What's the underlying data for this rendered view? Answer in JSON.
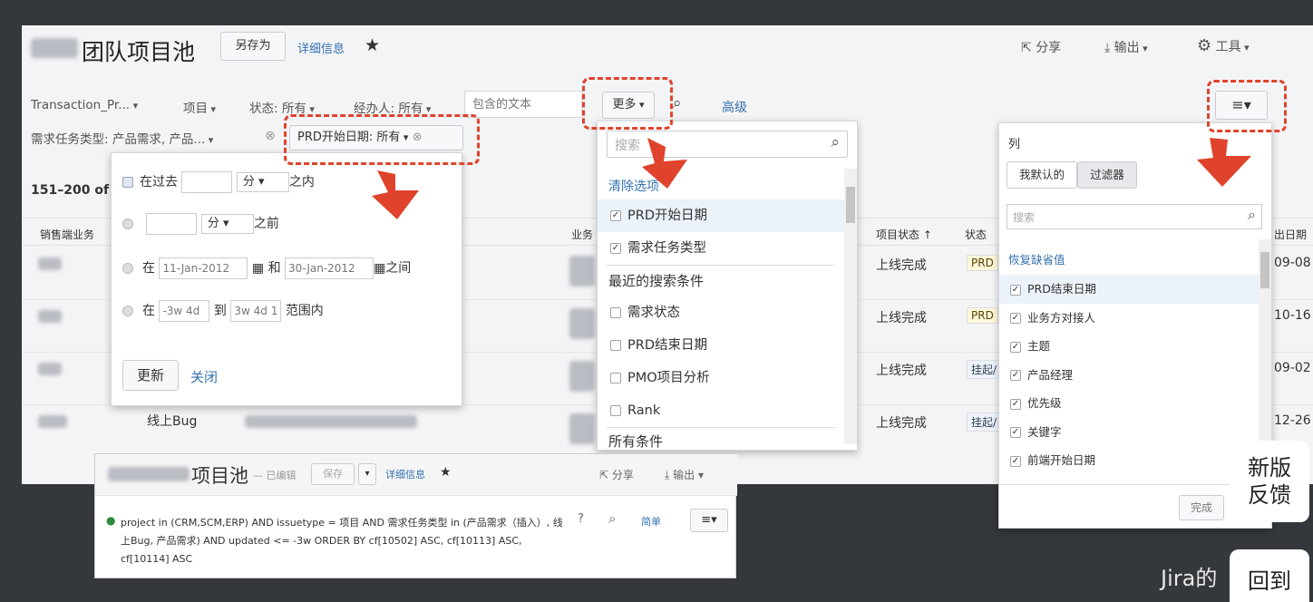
{
  "header": {
    "title": "团队项目池",
    "save_as": "另存为",
    "details": "详细信息",
    "share": "分享",
    "export": "输出",
    "tools": "工具"
  },
  "filters": {
    "transaction": "Transaction_Pr...",
    "project": "项目",
    "status": "状态: 所有",
    "assignee": "经办人: 所有",
    "text_placeholder": "包含的文本",
    "more": "更多",
    "advanced": "高级",
    "req_type": "需求任务类型: 产品需求, 产品...",
    "prd_start": "PRD开始日期: 所有"
  },
  "results": {
    "count": "151–200 of",
    "col_first": "销售端业务",
    "col_biz": "业务",
    "col_proj_status": "项目状态 ↑",
    "col_status": "状态",
    "col_date": "出日期",
    "rows": [
      {
        "proj_status": "上线完成",
        "status": "PRD",
        "date": "09-08"
      },
      {
        "proj_status": "上线完成",
        "status": "PRD",
        "date": "10-16"
      },
      {
        "proj_status": "上线完成",
        "status": "挂起/",
        "date": "09-02"
      },
      {
        "proj_status": "上线完成",
        "status": "挂起/",
        "date": "12-26",
        "type": "线上Bug"
      }
    ]
  },
  "date_popup": {
    "opt1_prefix": "在过去",
    "opt1_unit": "分",
    "opt1_suffix": "之内",
    "opt2_unit": "分",
    "opt2_suffix": "之前",
    "opt3_prefix": "在",
    "opt3_from": "11-Jan-2012",
    "opt3_and": "和",
    "opt3_to": "30-Jan-2012",
    "opt3_suffix": "之间",
    "opt4_prefix": "在",
    "opt4_from": "-3w 4d",
    "opt4_to_word": "到",
    "opt4_to": "3w 4d 1",
    "opt4_suffix": "范围内",
    "update": "更新",
    "close": "关闭"
  },
  "more_popup": {
    "search_placeholder": "搜索",
    "clear": "清除选项",
    "checked": [
      "PRD开始日期",
      "需求任务类型"
    ],
    "recent_header": "最近的搜索条件",
    "recent": [
      "需求状态",
      "PRD结束日期",
      "PMO项目分析",
      "Rank"
    ],
    "all_header": "所有条件"
  },
  "columns_popup": {
    "title": "列",
    "tab_mine": "我默认的",
    "tab_filter": "过滤器",
    "search_placeholder": "搜索",
    "restore": "恢复缺省值",
    "items": [
      "PRD结束日期",
      "业务方对接人",
      "主题",
      "产品经理",
      "优先级",
      "关键字",
      "前端开始日期"
    ],
    "done": "完成"
  },
  "inset": {
    "title": "项目池",
    "edited": "— 已编辑",
    "save": "保存",
    "details": "详细信息",
    "share": "分享",
    "export": "输出",
    "jql": "project in (CRM,SCM,ERP) AND issuetype = 项目 AND 需求任务类型 in (产品需求（插入）, 线上Bug, 产品需求) AND updated <= -3w ORDER BY cf[10502] ASC, cf[10113] ASC, cf[10114] ASC",
    "simple": "简单"
  },
  "side": {
    "feedback": "新版反馈",
    "back": "回到",
    "caption": "Jira的"
  }
}
